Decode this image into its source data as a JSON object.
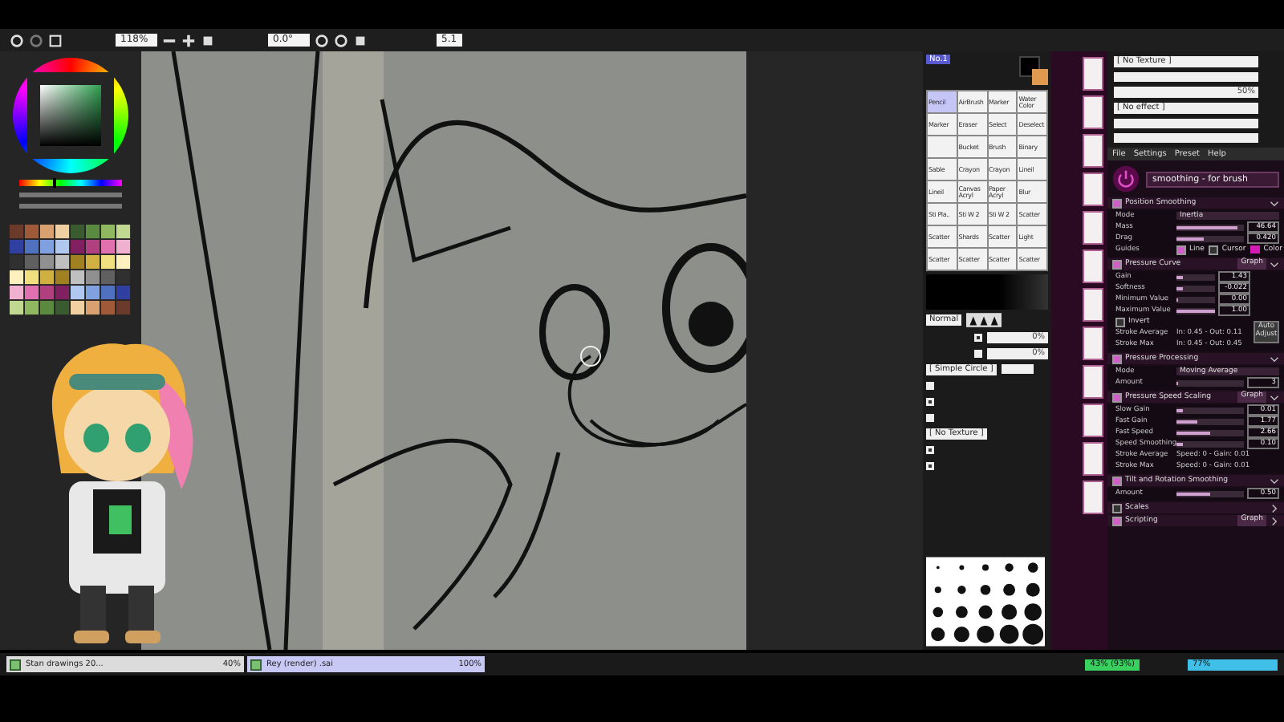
{
  "toolbar": {
    "zoom": "118%",
    "angle": "0.0°",
    "stabilizer": "5.1"
  },
  "color_picker": {
    "level": 0.35
  },
  "brush_panel": {
    "tab": "No.1",
    "tools": [
      {
        "label": "Pencil",
        "selected": true
      },
      {
        "label": "AirBrush",
        "selected": false
      },
      {
        "label": "Marker",
        "selected": false
      },
      {
        "label": "Water Color",
        "selected": false
      },
      {
        "label": "Marker",
        "selected": false
      },
      {
        "label": "Eraser",
        "selected": false
      },
      {
        "label": "Select",
        "selected": false
      },
      {
        "label": "Deselect",
        "selected": false
      },
      {
        "selected": false
      },
      {
        "label": "Bucket",
        "selected": false
      },
      {
        "label": "Brush",
        "selected": false
      },
      {
        "label": "Binary",
        "selected": false
      },
      {
        "label": "Sable",
        "selected": false
      },
      {
        "label": "Crayon",
        "selected": false
      },
      {
        "label": "Crayon",
        "selected": false
      },
      {
        "label": "Lineil",
        "selected": false
      },
      {
        "label": "Lineil",
        "selected": false
      },
      {
        "label": "Canvas Acryl",
        "selected": false
      },
      {
        "label": "Paper Acryl",
        "selected": false
      },
      {
        "label": "Blur",
        "selected": false
      },
      {
        "label": "Sti Pla..",
        "selected": false
      },
      {
        "label": "Sti W 2",
        "selected": false
      },
      {
        "label": "Sti W 2",
        "selected": false
      },
      {
        "label": "Scatter",
        "selected": false
      },
      {
        "label": "Scatter",
        "selected": false
      },
      {
        "label": "Shards",
        "selected": false
      },
      {
        "label": "Scatter",
        "selected": false
      },
      {
        "label": "Light",
        "selected": false
      },
      {
        "label": "Scatter",
        "selected": false
      },
      {
        "label": "Scatter",
        "selected": false
      },
      {
        "label": "Scatter",
        "selected": false
      },
      {
        "label": "Scatter",
        "selected": false
      }
    ],
    "blend_mode": "Normal",
    "pressure_rows": [
      {
        "checked": true,
        "reading": "0%"
      },
      {
        "checked": false,
        "reading": "0%"
      }
    ],
    "shape": "[ Simple Circle ]",
    "options": [
      {
        "checked": false
      },
      {
        "checked": true
      },
      {
        "checked": false
      }
    ],
    "texture": "[ No Texture ]",
    "options_2": [
      {
        "checked": true
      },
      {
        "checked": true
      }
    ]
  },
  "texture_panel": {
    "texture": "[ No Texture ]",
    "texture_reading": "50%",
    "effect": "[ No effect ]"
  },
  "smoothing": {
    "menu": [
      "File",
      "Settings",
      "Preset",
      "Help"
    ],
    "preset": "smoothing - for brush",
    "sections": [
      {
        "title": "Position Smoothing",
        "checked": true,
        "expanded": true,
        "rows": [
          {
            "kind": "select",
            "label": "Mode",
            "value": "Inertia"
          },
          {
            "kind": "slider",
            "label": "Mass",
            "level": 0.9,
            "value": "46.64"
          },
          {
            "kind": "slider",
            "label": "Drag",
            "level": 0.4,
            "value": "0.420"
          },
          {
            "kind": "guides",
            "label": "Guides",
            "items": [
              {
                "label": "Line",
                "checked": true
              },
              {
                "label": "Cursor",
                "checked": false
              }
            ],
            "swatch": {
              "label": "Color",
              "color": "#d41cb4"
            }
          }
        ]
      },
      {
        "title": "Pressure Curve",
        "checked": true,
        "expanded": true,
        "graph": "Graph",
        "button": "Auto Adjust",
        "rows": [
          {
            "kind": "slider",
            "label": "Gain",
            "level": 0.15,
            "value": "1.43"
          },
          {
            "kind": "slider",
            "label": "Softness",
            "level": 0.18,
            "value": "-0.022"
          },
          {
            "kind": "slider",
            "label": "Minimum Value",
            "level": 0.05,
            "value": "0.00"
          },
          {
            "kind": "slider",
            "label": "Maximum Value",
            "level": 1.0,
            "value": "1.00"
          },
          {
            "kind": "check",
            "label": "Invert",
            "checked": false
          },
          {
            "kind": "readout",
            "label": "Stroke Average",
            "value": "In: 0.45 - Out: 0.11"
          },
          {
            "kind": "readout",
            "label": "Stroke Max",
            "value": "In: 0.45 - Out: 0.45"
          }
        ]
      },
      {
        "title": "Pressure Processing",
        "checked": true,
        "expanded": true,
        "rows": [
          {
            "kind": "select",
            "label": "Mode",
            "value": "Moving Average"
          },
          {
            "kind": "slider",
            "label": "Amount",
            "level": 0.03,
            "value": "3"
          }
        ]
      },
      {
        "title": "Pressure Speed Scaling",
        "checked": true,
        "expanded": true,
        "graph": "Graph",
        "rows": [
          {
            "kind": "slider",
            "label": "Slow Gain",
            "level": 0.1,
            "value": "0.01"
          },
          {
            "kind": "slider",
            "label": "Fast Gain",
            "level": 0.3,
            "value": "1.77"
          },
          {
            "kind": "slider",
            "label": "Fast Speed",
            "level": 0.5,
            "value": "2.66"
          },
          {
            "kind": "slider",
            "label": "Speed Smoothing",
            "level": 0.1,
            "value": "0.10"
          },
          {
            "kind": "readout",
            "label": "Stroke Average",
            "value": "Speed: 0 - Gain: 0.01"
          },
          {
            "kind": "readout",
            "label": "Stroke Max",
            "value": "Speed: 0 - Gain: 0.01"
          }
        ]
      },
      {
        "title": "Tilt and Rotation Smoothing",
        "checked": true,
        "expanded": true,
        "rows": [
          {
            "kind": "slider",
            "label": "Amount",
            "level": 0.5,
            "value": "0.50"
          }
        ]
      },
      {
        "title": "Scales",
        "checked": false,
        "expanded": false
      },
      {
        "title": "Scripting",
        "checked": true,
        "expanded": false,
        "graph": "Graph"
      }
    ]
  },
  "documents": [
    {
      "name": "Stan drawings 20...",
      "zoom": "40%",
      "selected": false
    },
    {
      "name": "Rey (render) .sai",
      "zoom": "100%",
      "selected": true
    }
  ],
  "status": {
    "memory": "43% (93%)",
    "drive": "77%"
  }
}
